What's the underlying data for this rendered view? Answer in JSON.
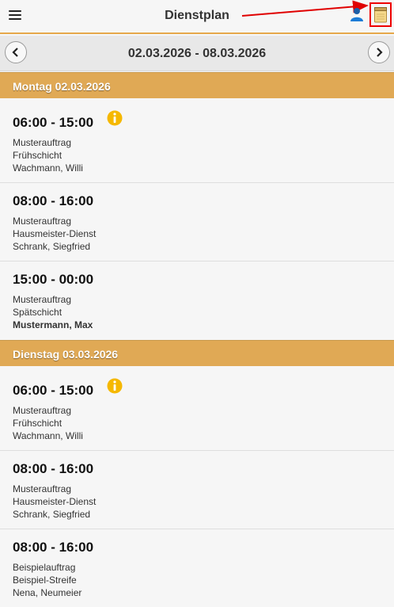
{
  "header": {
    "title": "Dienstplan",
    "icons": {
      "menu": "hamburger-menu-icon",
      "user": "user-icon",
      "notes": "notes-icon"
    }
  },
  "nav": {
    "date_range": "02.03.2026 - 08.03.2026"
  },
  "colors": {
    "accent": "#e0a955",
    "highlight_red": "#e00000"
  },
  "days": [
    {
      "label": "Montag 02.03.2026",
      "shifts": [
        {
          "time": "06:00 - 15:00",
          "info": true,
          "order": "Musterauftrag",
          "service": "Frühschicht",
          "employee": "Wachmann, Willi",
          "employee_bold": false
        },
        {
          "time": "08:00 - 16:00",
          "info": false,
          "order": "Musterauftrag",
          "service": "Hausmeister-Dienst",
          "employee": "Schrank, Siegfried",
          "employee_bold": false
        },
        {
          "time": "15:00 - 00:00",
          "info": false,
          "order": "Musterauftrag",
          "service": "Spätschicht",
          "employee": "Mustermann, Max",
          "employee_bold": true
        }
      ]
    },
    {
      "label": "Dienstag 03.03.2026",
      "shifts": [
        {
          "time": "06:00 - 15:00",
          "info": true,
          "order": "Musterauftrag",
          "service": "Frühschicht",
          "employee": "Wachmann, Willi",
          "employee_bold": false
        },
        {
          "time": "08:00 - 16:00",
          "info": false,
          "order": "Musterauftrag",
          "service": "Hausmeister-Dienst",
          "employee": "Schrank, Siegfried",
          "employee_bold": false
        },
        {
          "time": "08:00 - 16:00",
          "info": false,
          "order": "Beispielauftrag",
          "service": "Beispiel-Streife",
          "employee": "Nena, Neumeier",
          "employee_bold": false
        }
      ]
    }
  ]
}
